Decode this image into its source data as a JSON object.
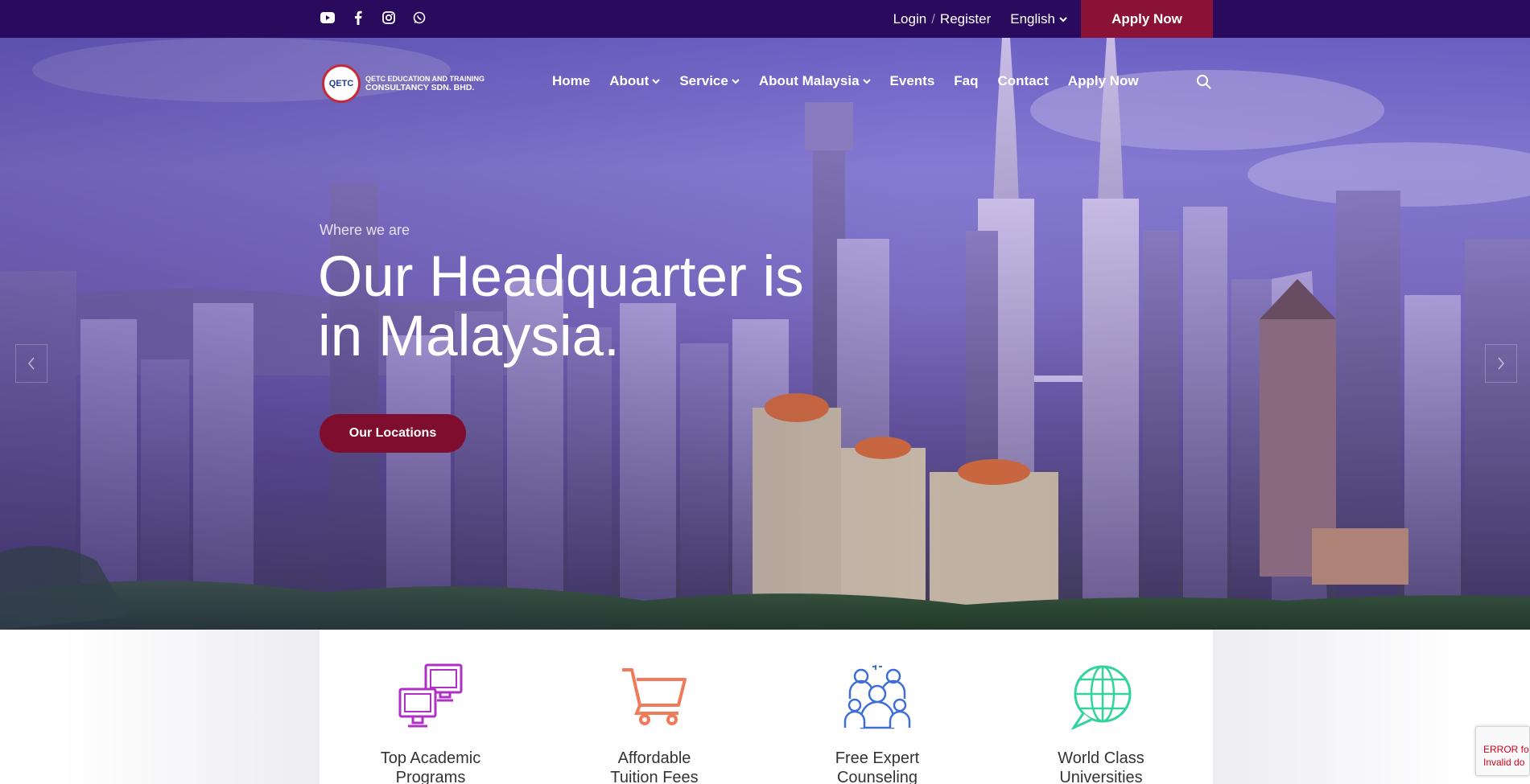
{
  "topbar": {
    "social_icons": [
      "youtube-icon",
      "facebook-icon",
      "instagram-icon",
      "whatsapp-icon"
    ],
    "login": "Login",
    "separator": "/",
    "register": "Register",
    "language": "English",
    "apply_now": "Apply Now",
    "bg_color": "#2a0a5c",
    "accent_color": "#8a1236"
  },
  "brand": {
    "badge": "QETC",
    "line1": "QETC EDUCATION AND TRAINING",
    "line2": "CONSULTANCY SDN. BHD."
  },
  "nav": {
    "items": [
      {
        "label": "Home"
      },
      {
        "label": "About"
      },
      {
        "label": "Service"
      },
      {
        "label": "About Malaysia"
      },
      {
        "label": "Events"
      },
      {
        "label": "Faq"
      },
      {
        "label": "Contact"
      },
      {
        "label": "Apply Now"
      }
    ]
  },
  "hero": {
    "eyebrow": "Where we are",
    "headline_line1": "Our Headquarter is",
    "headline_line2": "in Malaysia.",
    "cta": "Our Locations"
  },
  "features": [
    {
      "line1": "Top Academic",
      "line2": "Programs",
      "icon": "computers-icon",
      "color": "#b02fc4"
    },
    {
      "line1": "Affordable",
      "line2": "Tuition Fees",
      "icon": "shopping-cart-icon",
      "color": "#f07a5a"
    },
    {
      "line1": "Free Expert",
      "line2": "Counseling",
      "icon": "team-icon",
      "color": "#3f6fd6"
    },
    {
      "line1": "World Class",
      "line2": "Universities",
      "icon": "globe-chat-icon",
      "color": "#34d39a"
    }
  ],
  "recaptcha": {
    "line1": "ERROR fo",
    "line2": "Invalid do"
  }
}
